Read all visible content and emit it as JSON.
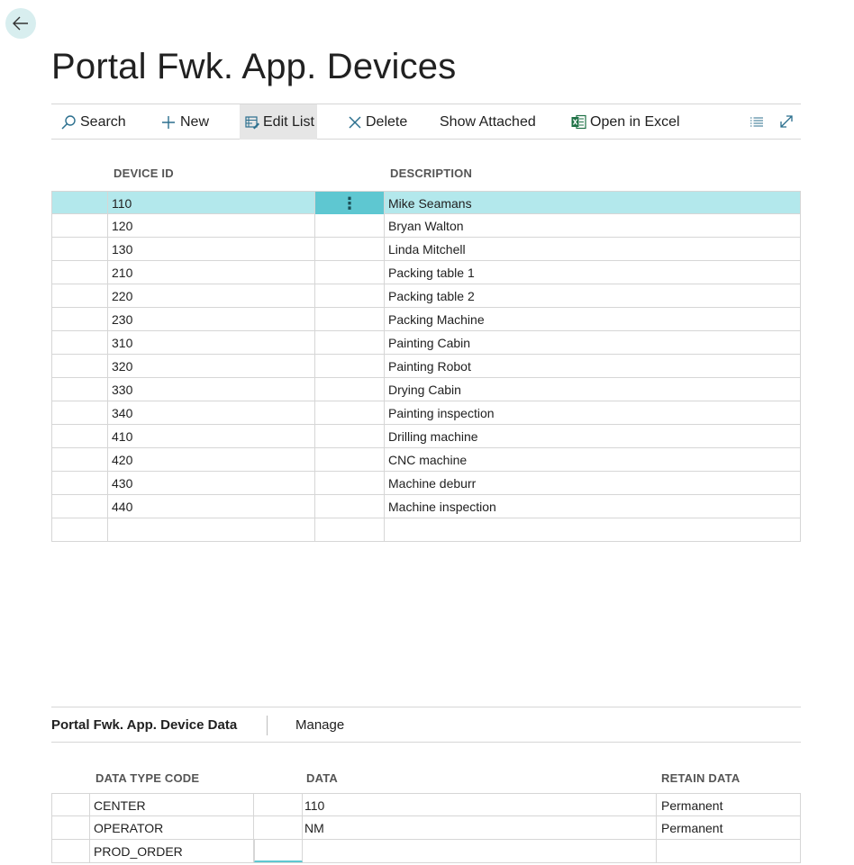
{
  "page": {
    "title": "Portal Fwk. App. Devices"
  },
  "actions": {
    "search": "Search",
    "new": "New",
    "edit_list": "Edit List",
    "delete": "Delete",
    "show_attached": "Show Attached",
    "open_in_excel": "Open in Excel"
  },
  "devices": {
    "headers": {
      "device_id": "DEVICE ID",
      "description": "DESCRIPTION"
    },
    "selected_row": 0,
    "rows": [
      {
        "id": "110",
        "description": "Mike Seamans"
      },
      {
        "id": "120",
        "description": "Bryan Walton"
      },
      {
        "id": "130",
        "description": "Linda Mitchell"
      },
      {
        "id": "210",
        "description": "Packing table 1"
      },
      {
        "id": "220",
        "description": "Packing table 2"
      },
      {
        "id": "230",
        "description": "Packing Machine"
      },
      {
        "id": "310",
        "description": "Painting Cabin"
      },
      {
        "id": "320",
        "description": "Painting Robot"
      },
      {
        "id": "330",
        "description": "Drying Cabin"
      },
      {
        "id": "340",
        "description": "Painting inspection"
      },
      {
        "id": "410",
        "description": "Drilling machine"
      },
      {
        "id": "420",
        "description": "CNC machine"
      },
      {
        "id": "430",
        "description": "Machine deburr"
      },
      {
        "id": "440",
        "description": "Machine inspection"
      },
      {
        "id": "",
        "description": ""
      }
    ]
  },
  "subpart": {
    "title": "Portal Fwk. App. Device Data",
    "manage": "Manage",
    "headers": {
      "data_type_code": "DATA TYPE CODE",
      "data": "DATA",
      "retain_data": "RETAIN DATA"
    },
    "rows": [
      {
        "code": "CENTER",
        "data": "110",
        "retain": "Permanent"
      },
      {
        "code": "OPERATOR",
        "data": "NM",
        "retain": "Permanent"
      },
      {
        "code": "PROD_ORDER",
        "data": "",
        "retain": ""
      }
    ]
  },
  "colors": {
    "accent": "#5ec7d1",
    "selected_row": "#b3e8ec",
    "excel_green": "#1e7145"
  },
  "icons": [
    "back-arrow-icon",
    "search-icon",
    "plus-icon",
    "edit-list-icon",
    "delete-x-icon",
    "excel-icon",
    "list-view-icon",
    "expand-icon",
    "more-options-icon"
  ]
}
